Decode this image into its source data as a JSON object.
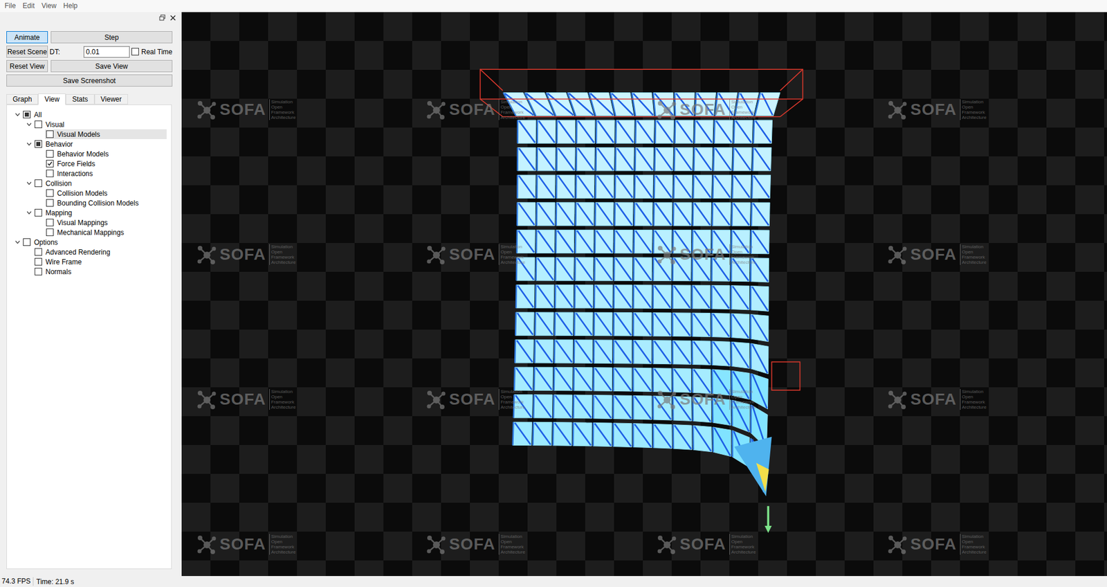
{
  "menu": [
    "File",
    "Edit",
    "View",
    "Help"
  ],
  "controls": {
    "animate": {
      "label": "Animate",
      "selected": true
    },
    "step": "Step",
    "reset_scene": "Reset Scene",
    "dt_label": "DT:",
    "dt_value": "0.01",
    "real_time": {
      "label": "Real Time",
      "checked": false
    },
    "reset_view": "Reset View",
    "save_view": "Save View",
    "save_screenshot": "Save Screenshot"
  },
  "tabs": [
    {
      "label": "Graph",
      "selected": false
    },
    {
      "label": "View",
      "selected": true
    },
    {
      "label": "Stats",
      "selected": false
    },
    {
      "label": "Viewer",
      "selected": false
    }
  ],
  "tree": [
    {
      "label": "All",
      "checked": false,
      "partial": true,
      "expanded": true,
      "selected": false,
      "children": [
        {
          "label": "Visual",
          "checked": false,
          "partial": false,
          "expanded": true,
          "selected": false,
          "children": [
            {
              "label": "Visual Models",
              "checked": false,
              "partial": false,
              "selected": true
            }
          ]
        },
        {
          "label": "Behavior",
          "checked": false,
          "partial": true,
          "expanded": true,
          "selected": false,
          "children": [
            {
              "label": "Behavior Models",
              "checked": false,
              "partial": false,
              "selected": false
            },
            {
              "label": "Force Fields",
              "checked": true,
              "partial": false,
              "selected": false
            },
            {
              "label": "Interactions",
              "checked": false,
              "partial": false,
              "selected": false
            }
          ]
        },
        {
          "label": "Collision",
          "checked": false,
          "partial": false,
          "expanded": true,
          "selected": false,
          "children": [
            {
              "label": "Collision Models",
              "checked": false,
              "partial": false,
              "selected": false
            },
            {
              "label": "Bounding Collision Models",
              "checked": false,
              "partial": false,
              "selected": false
            }
          ]
        },
        {
          "label": "Mapping",
          "checked": false,
          "partial": false,
          "expanded": true,
          "selected": false,
          "children": [
            {
              "label": "Visual Mappings",
              "checked": false,
              "partial": false,
              "selected": false
            },
            {
              "label": "Mechanical Mappings",
              "checked": false,
              "partial": false,
              "selected": false
            }
          ]
        }
      ]
    },
    {
      "label": "Options",
      "checked": false,
      "partial": false,
      "expanded": true,
      "selected": false,
      "children": [
        {
          "label": "Advanced Rendering",
          "checked": false,
          "partial": false,
          "selected": false
        },
        {
          "label": "Wire Frame",
          "checked": false,
          "partial": false,
          "selected": false
        },
        {
          "label": "Normals",
          "checked": false,
          "partial": false,
          "selected": false
        }
      ]
    }
  ],
  "viewport": {
    "watermark": {
      "logo": "SOFA",
      "tagline": [
        "Simulation",
        "Open",
        "Framework",
        "Architecture"
      ]
    }
  },
  "status_bar": {
    "fps": "74.3 FPS",
    "time": "Time: 21.9 s"
  }
}
